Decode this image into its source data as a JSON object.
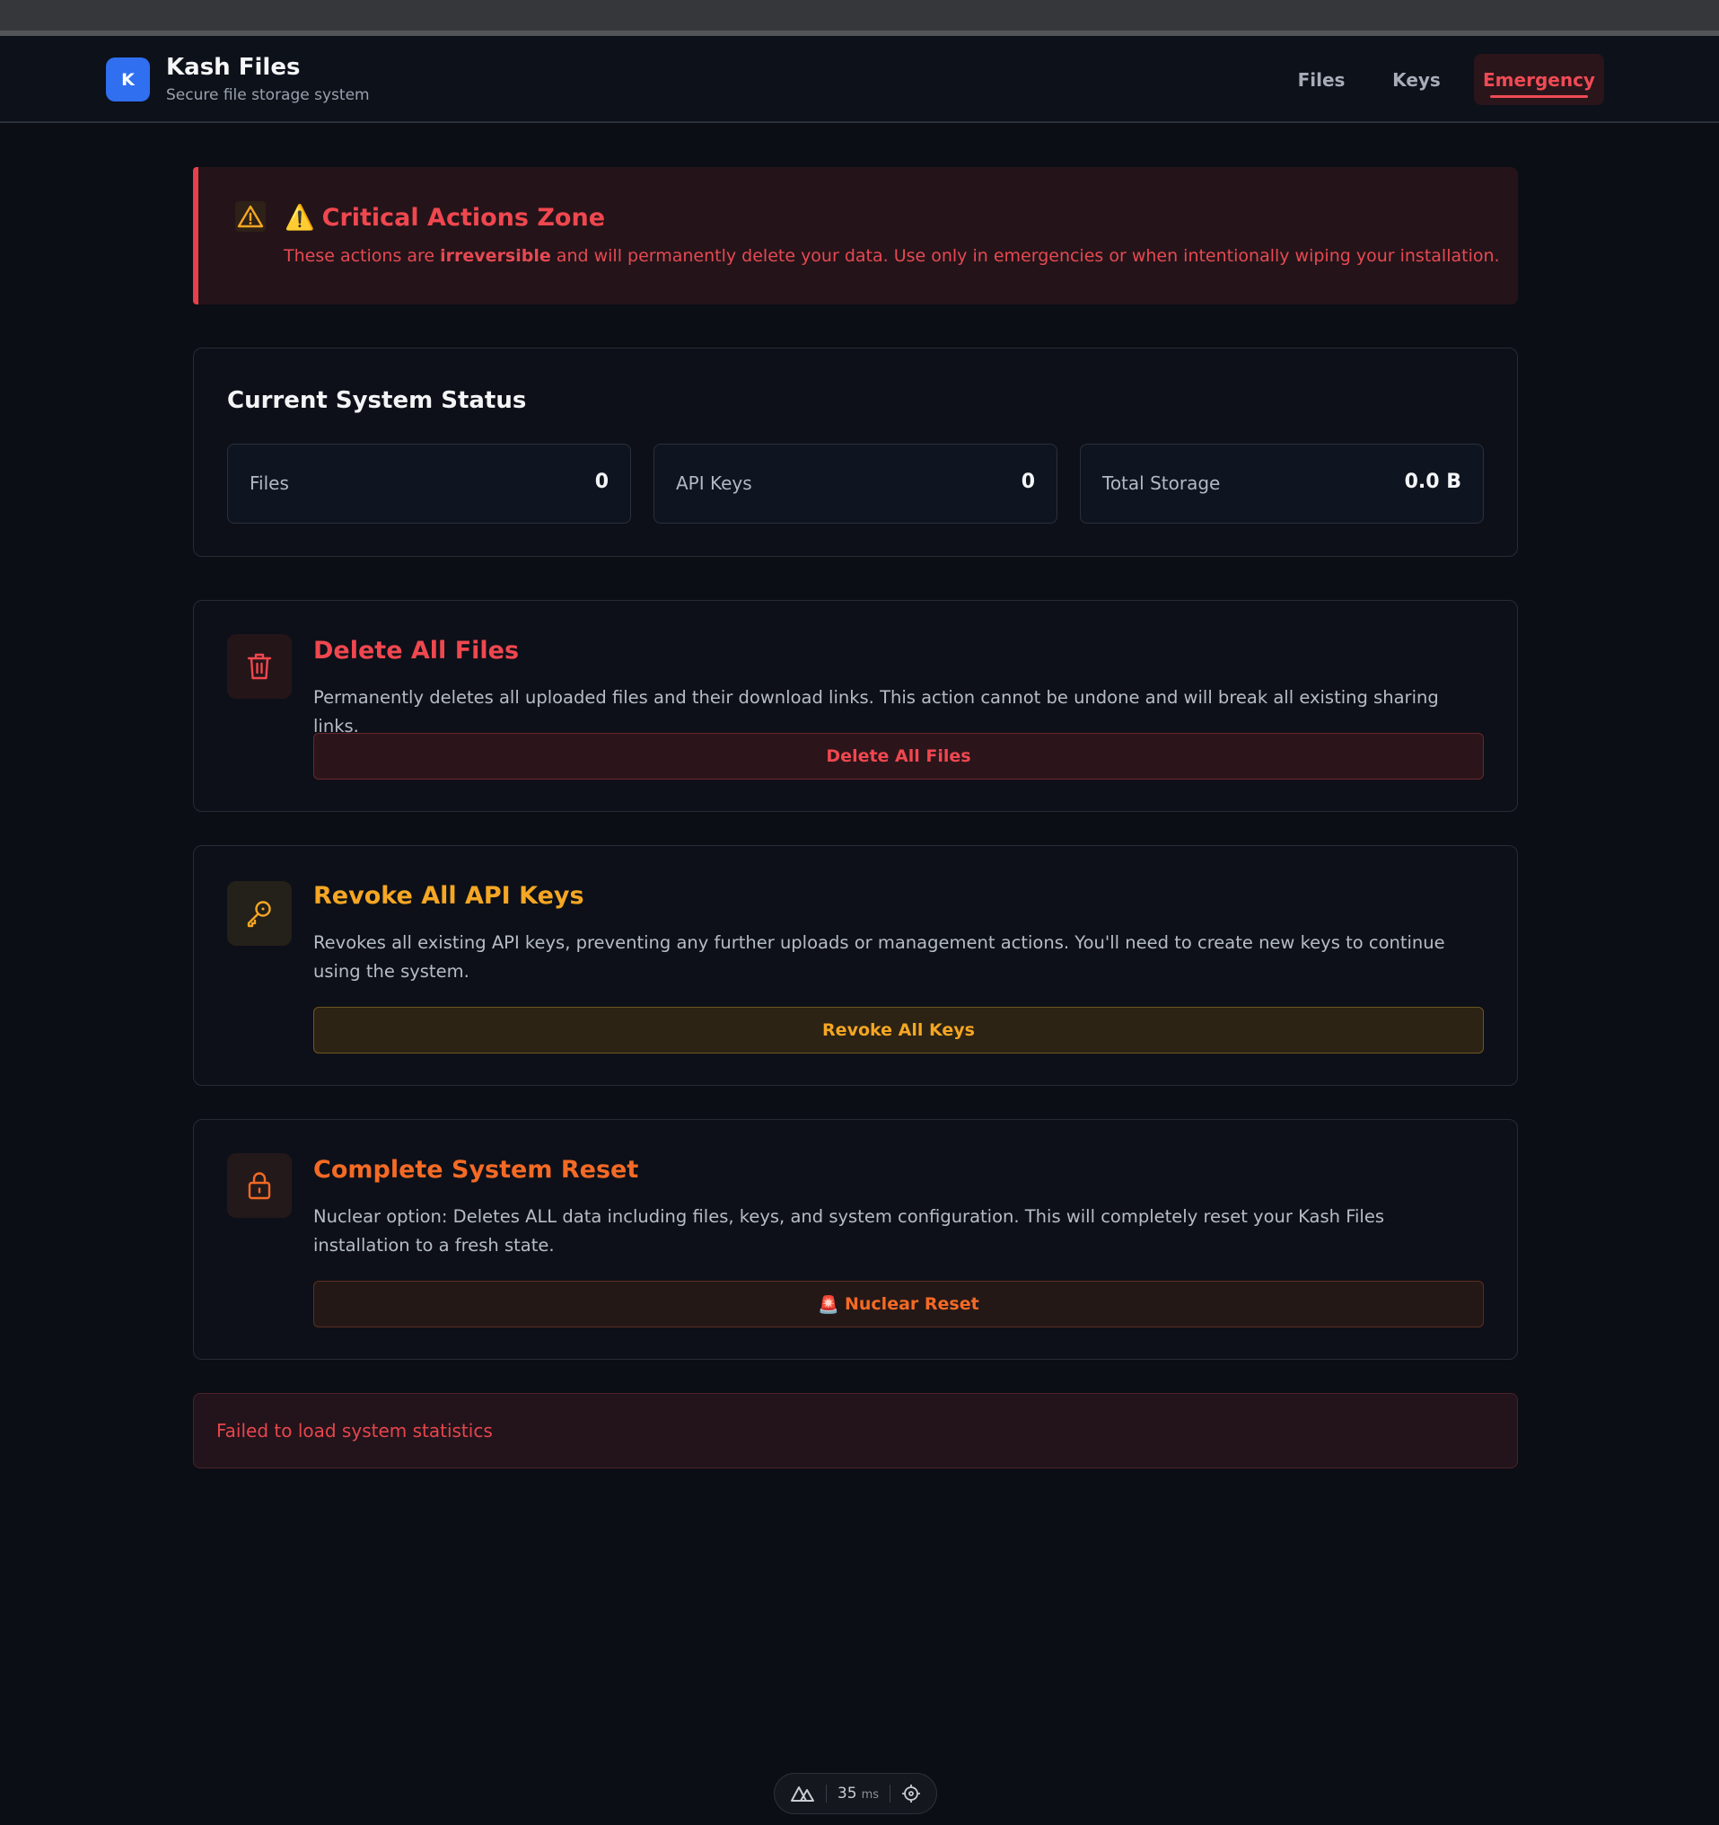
{
  "header": {
    "logo_letter": "K",
    "app_title": "Kash Files",
    "app_subtitle": "Secure file storage system",
    "nav": {
      "files": "Files",
      "keys": "Keys",
      "emergency": "Emergency"
    },
    "active_nav": "Emergency"
  },
  "alert": {
    "icon": "warning-triangle-icon",
    "title_emoji": "⚠️",
    "title": "Critical Actions Zone",
    "text_prefix": "These actions are ",
    "text_bold": "irreversible",
    "text_suffix": " and will permanently delete your data. Use only in emergencies or when intentionally wiping your installation."
  },
  "status": {
    "title": "Current System Status",
    "stats": [
      {
        "label": "Files",
        "value": "0"
      },
      {
        "label": "API Keys",
        "value": "0"
      },
      {
        "label": "Total Storage",
        "value": "0.0 B"
      }
    ]
  },
  "actions": {
    "delete_files": {
      "icon": "trash-icon",
      "title": "Delete All Files",
      "description": "Permanently deletes all uploaded files and their download links. This action cannot be undone and will break all existing sharing links.",
      "button": "Delete All Files",
      "color": "#f0474f"
    },
    "revoke_keys": {
      "icon": "key-icon",
      "title": "Revoke All API Keys",
      "description": "Revokes all existing API keys, preventing any further uploads or management actions. You'll need to create new keys to continue using the system.",
      "button": "Revoke All Keys",
      "color": "#f5a623"
    },
    "nuclear_reset": {
      "icon": "lock-icon",
      "title": "Complete System Reset",
      "description": "Nuclear option: Deletes ALL data including files, keys, and system configuration. This will completely reset your Kash Files installation to a fresh state.",
      "button_emoji": "🚨",
      "button": "Nuclear Reset",
      "color": "#f46a25"
    }
  },
  "error": {
    "text": "Failed to load system statistics"
  },
  "perf_widget": {
    "ms": "35",
    "unit": "ms"
  }
}
